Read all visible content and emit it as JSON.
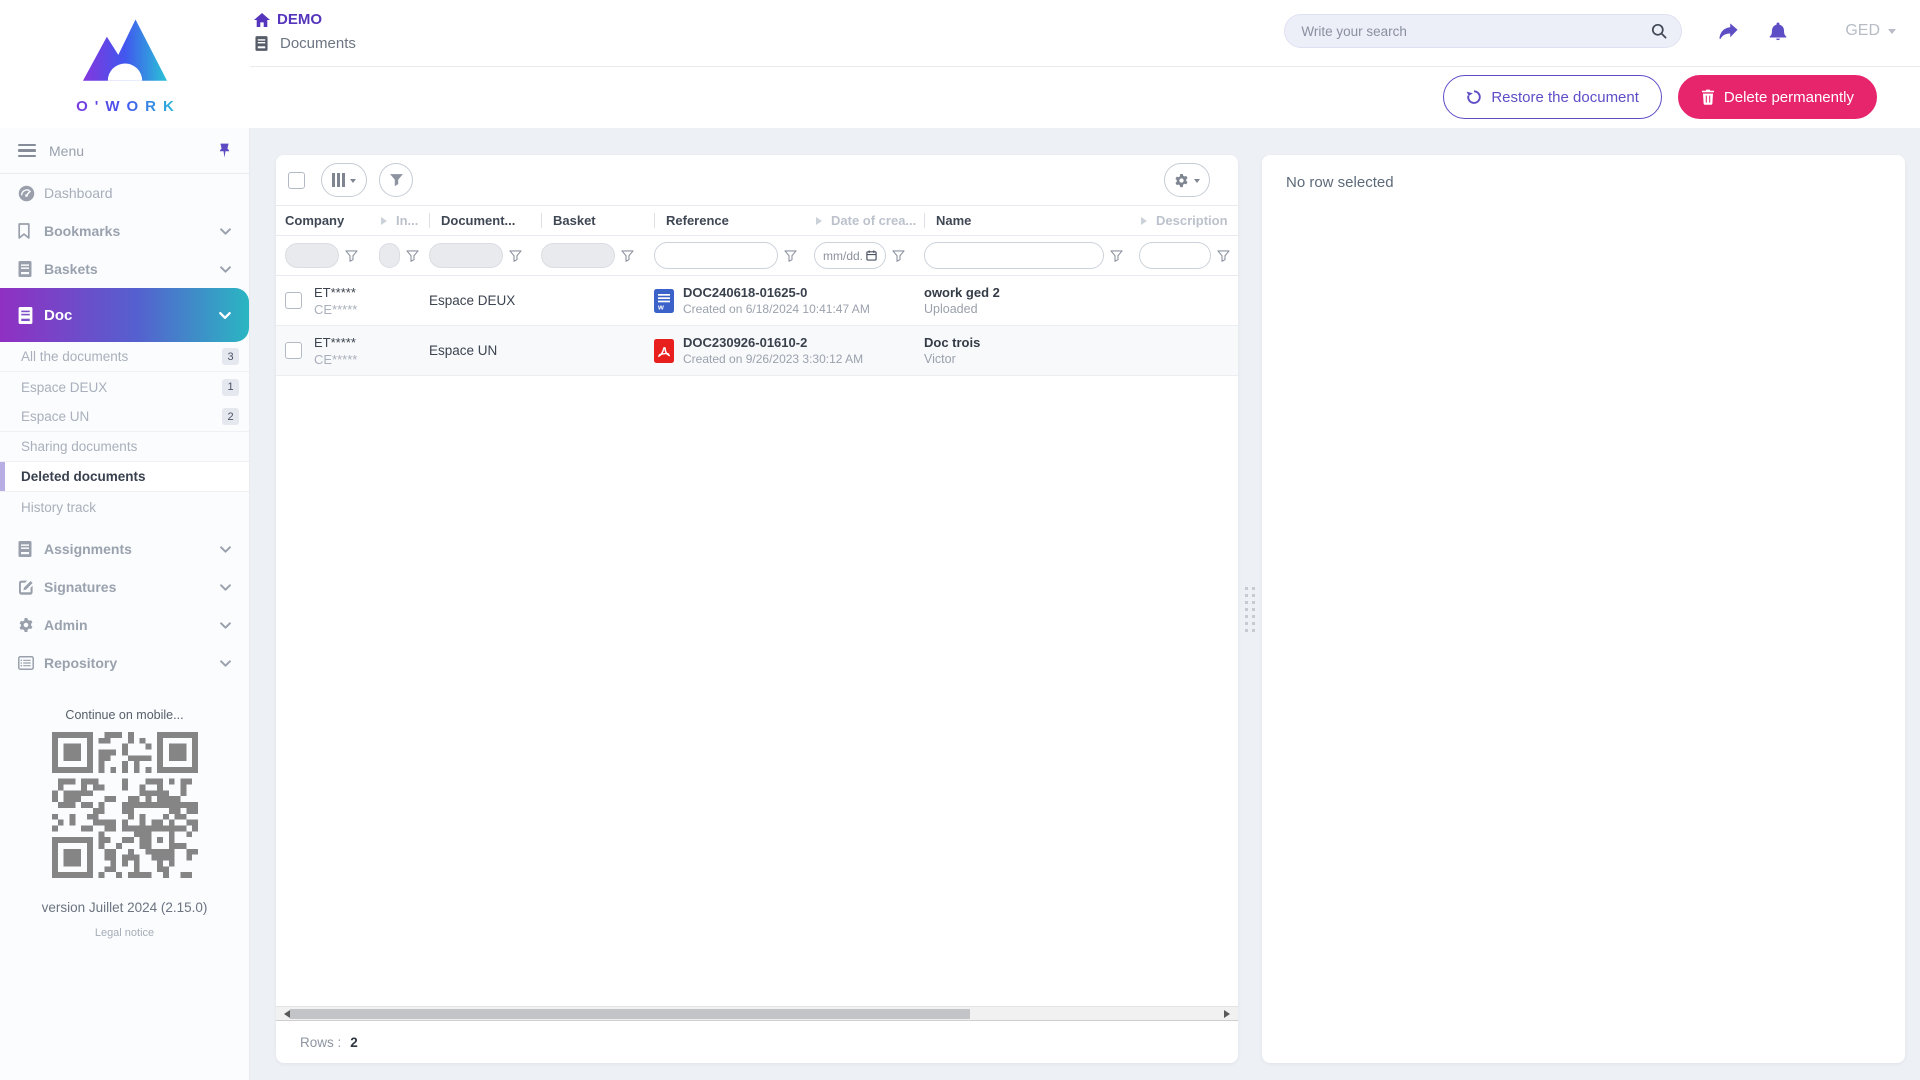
{
  "header": {
    "brand": "O'WORK",
    "environment": "DEMO",
    "page_title": "Documents",
    "search": {
      "placeholder": "Write your search"
    },
    "user_menu_label": "GED",
    "actions": {
      "restore": "Restore the document",
      "delete": "Delete permanently"
    }
  },
  "sidebar": {
    "menu_label": "Menu",
    "items": [
      {
        "label": "Dashboard"
      },
      {
        "label": "Bookmarks"
      },
      {
        "label": "Baskets"
      },
      {
        "label": "Doc"
      },
      {
        "label": "Assignments"
      },
      {
        "label": "Signatures"
      },
      {
        "label": "Admin"
      },
      {
        "label": "Repository"
      }
    ],
    "doc_children": [
      {
        "label": "All the documents",
        "badge": "3"
      },
      {
        "label": "Espace DEUX",
        "badge": "1"
      },
      {
        "label": "Espace UN",
        "badge": "2"
      },
      {
        "label": "Sharing documents"
      },
      {
        "label": "Deleted documents"
      },
      {
        "label": "History track"
      }
    ],
    "mobile": {
      "caption": "Continue on mobile...",
      "version": "version Juillet 2024 (2.15.0)",
      "legal": "Legal notice"
    }
  },
  "table": {
    "columns": [
      {
        "label": "Company"
      },
      {
        "label": "In..."
      },
      {
        "label": "Document..."
      },
      {
        "label": "Basket"
      },
      {
        "label": "Reference"
      },
      {
        "label": "Date of crea..."
      },
      {
        "label": "Name"
      },
      {
        "label": "Description"
      }
    ],
    "date_filter_placeholder": "mm/dd.",
    "rows": [
      {
        "company": "ET*****",
        "company_sub": "CE*****",
        "document": "Espace DEUX",
        "file_type": "word",
        "reference": "DOC240618-01625-0",
        "created": "Created on 6/18/2024 10:41:47 AM",
        "name": "owork ged 2",
        "name_sub": "Uploaded"
      },
      {
        "company": "ET*****",
        "company_sub": "CE*****",
        "document": "Espace UN",
        "file_type": "pdf",
        "reference": "DOC230926-01610-2",
        "created": "Created on 9/26/2023 3:30:12 AM",
        "name": "Doc trois",
        "name_sub": "Victor"
      }
    ],
    "footer": {
      "rows_label": "Rows :",
      "count": "2"
    }
  },
  "detail_panel": {
    "empty_text": "No row selected"
  },
  "colors": {
    "accent_purple": "#5d4ec6",
    "demo_purple": "#5435bb",
    "delete_pink": "#e7256d",
    "gradient_start": "#9030c2",
    "gradient_end": "#2ab6c2",
    "word_blue": "#3a62c8",
    "pdf_red": "#e8201d"
  }
}
